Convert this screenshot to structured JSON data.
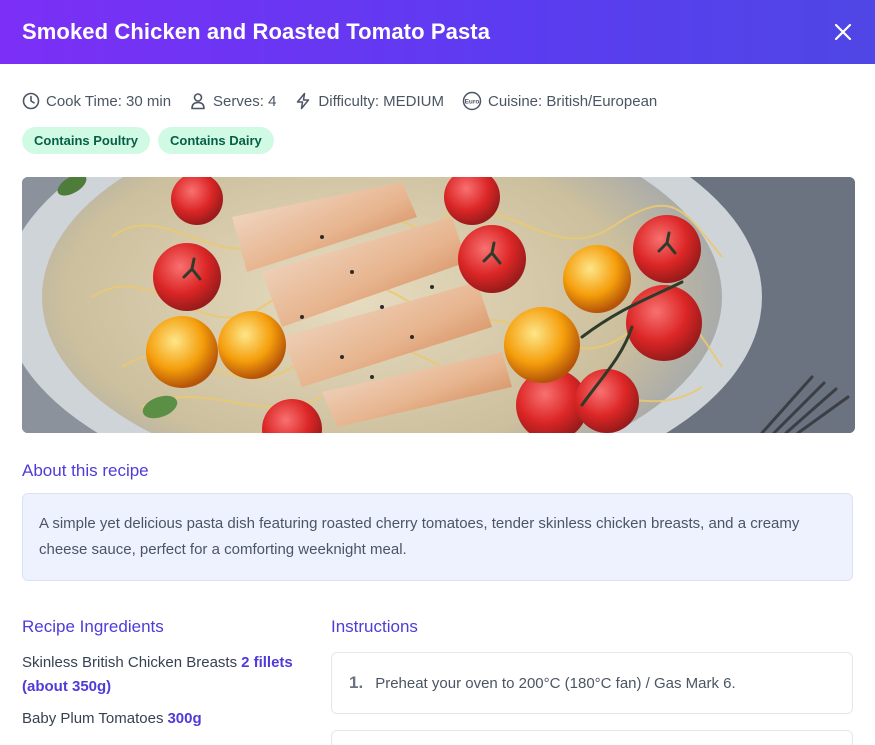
{
  "header": {
    "title": "Smoked Chicken and Roasted Tomato Pasta",
    "close_icon": "close-icon"
  },
  "meta": {
    "cook_time": "Cook Time: 30 min",
    "serves": "Serves: 4",
    "difficulty": "Difficulty: MEDIUM",
    "cuisine": "Cuisine: British/European",
    "icons": [
      "clock-icon",
      "person-icon",
      "bolt-icon",
      "cuisine-badge-icon"
    ],
    "cuisine_badge_text": "Euro"
  },
  "tags": [
    "Contains Poultry",
    "Contains Dairy"
  ],
  "colors": {
    "header_start": "#7c2ff6",
    "header_end": "#4f46e5",
    "accent": "#4f3bd9",
    "tag_bg": "#d1fae5",
    "tag_text": "#065f46",
    "about_bg": "#eef2ff"
  },
  "about": {
    "title": "About this recipe",
    "text": "A simple yet delicious pasta dish featuring roasted cherry tomatoes, tender skinless chicken breasts, and a creamy cheese sauce, perfect for a comforting weeknight meal."
  },
  "ingredients": {
    "title": "Recipe Ingredients",
    "items": [
      {
        "name": "Skinless British Chicken Breasts",
        "qty": "2 fillets (about 350g)"
      },
      {
        "name": "Baby Plum Tomatoes",
        "qty": "300g"
      }
    ]
  },
  "instructions": {
    "title": "Instructions",
    "steps": [
      {
        "num": "1.",
        "text": "Preheat your oven to 200°C (180°C fan) / Gas Mark 6."
      }
    ]
  }
}
